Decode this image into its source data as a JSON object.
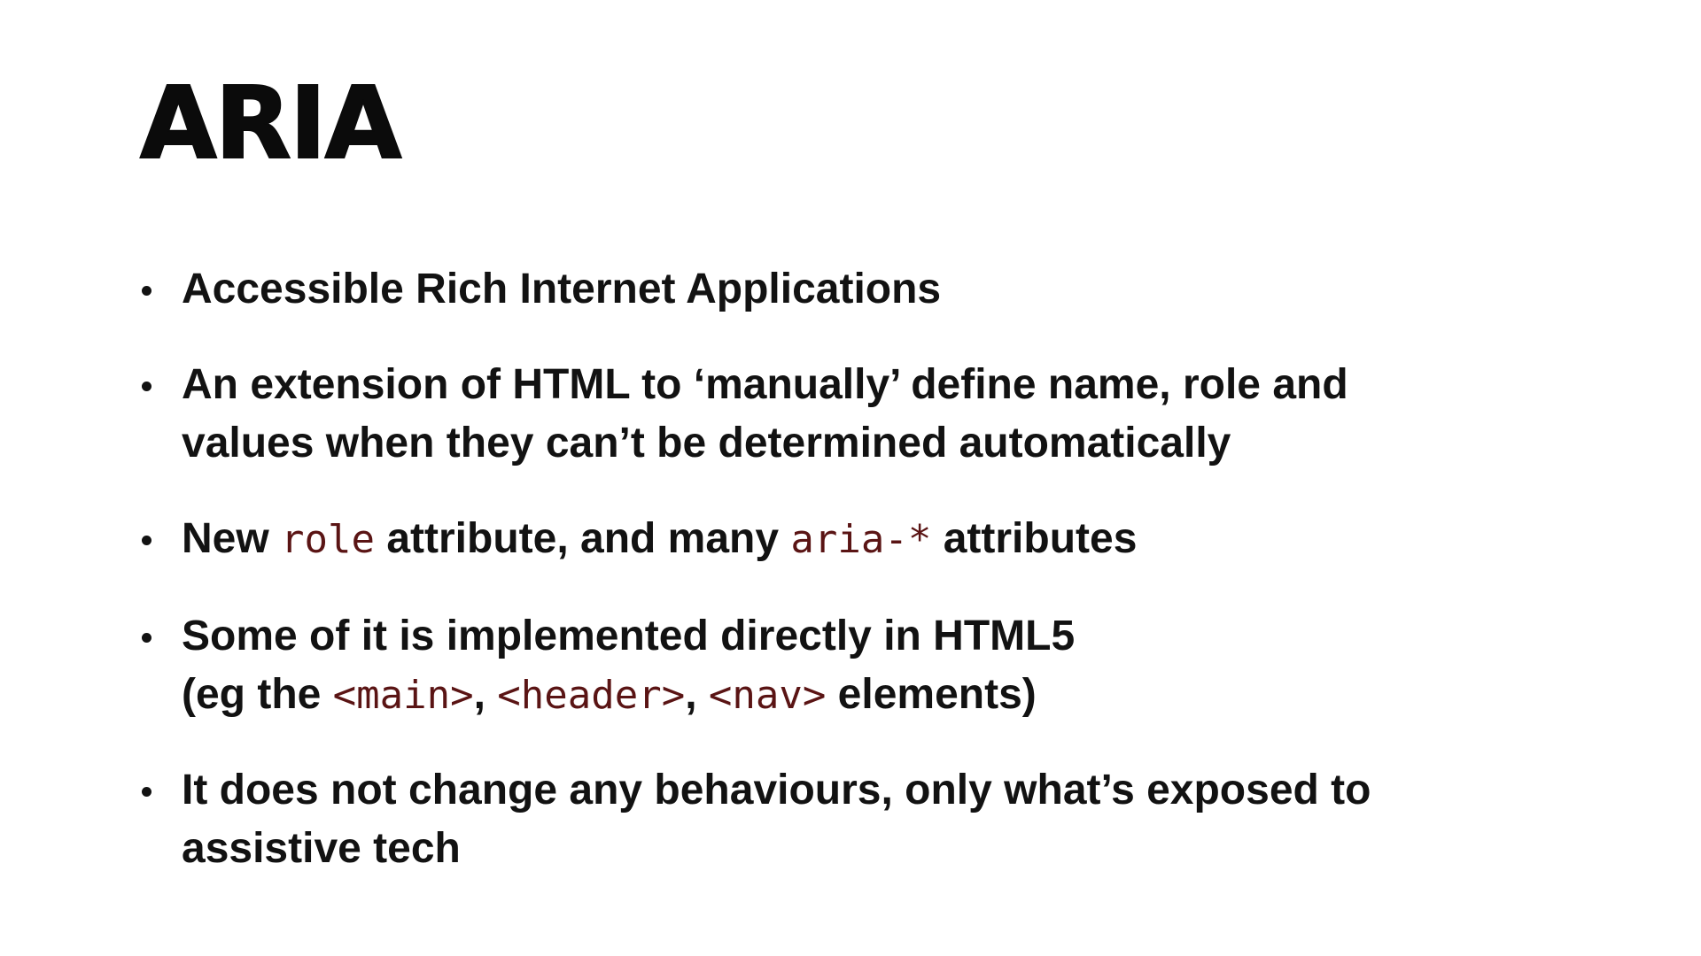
{
  "slide": {
    "title": "ARIA",
    "bullets": {
      "b1": {
        "text": "Accessible Rich Internet Applications"
      },
      "b2": {
        "line1": "An extension of HTML to ‘manually’ define name, role and",
        "line2": "values when they can’t be determined automatically"
      },
      "b3": {
        "t1": "New ",
        "code1": "role",
        "t2": " attribute, and many ",
        "code2": "aria-*",
        "t3": " attributes"
      },
      "b4": {
        "line1": "Some of it is implemented directly in HTML5",
        "t1": "(eg the ",
        "code1": "<main>",
        "t2": ", ",
        "code2": "<header>",
        "t3": ", ",
        "code3": "<nav>",
        "t4": " elements)"
      },
      "b5": {
        "line1": "It does not change any behaviours, only what’s exposed to",
        "line2": "assistive tech"
      }
    }
  },
  "colors": {
    "text": "#121212",
    "code": "#5a1414",
    "background": "#ffffff"
  }
}
